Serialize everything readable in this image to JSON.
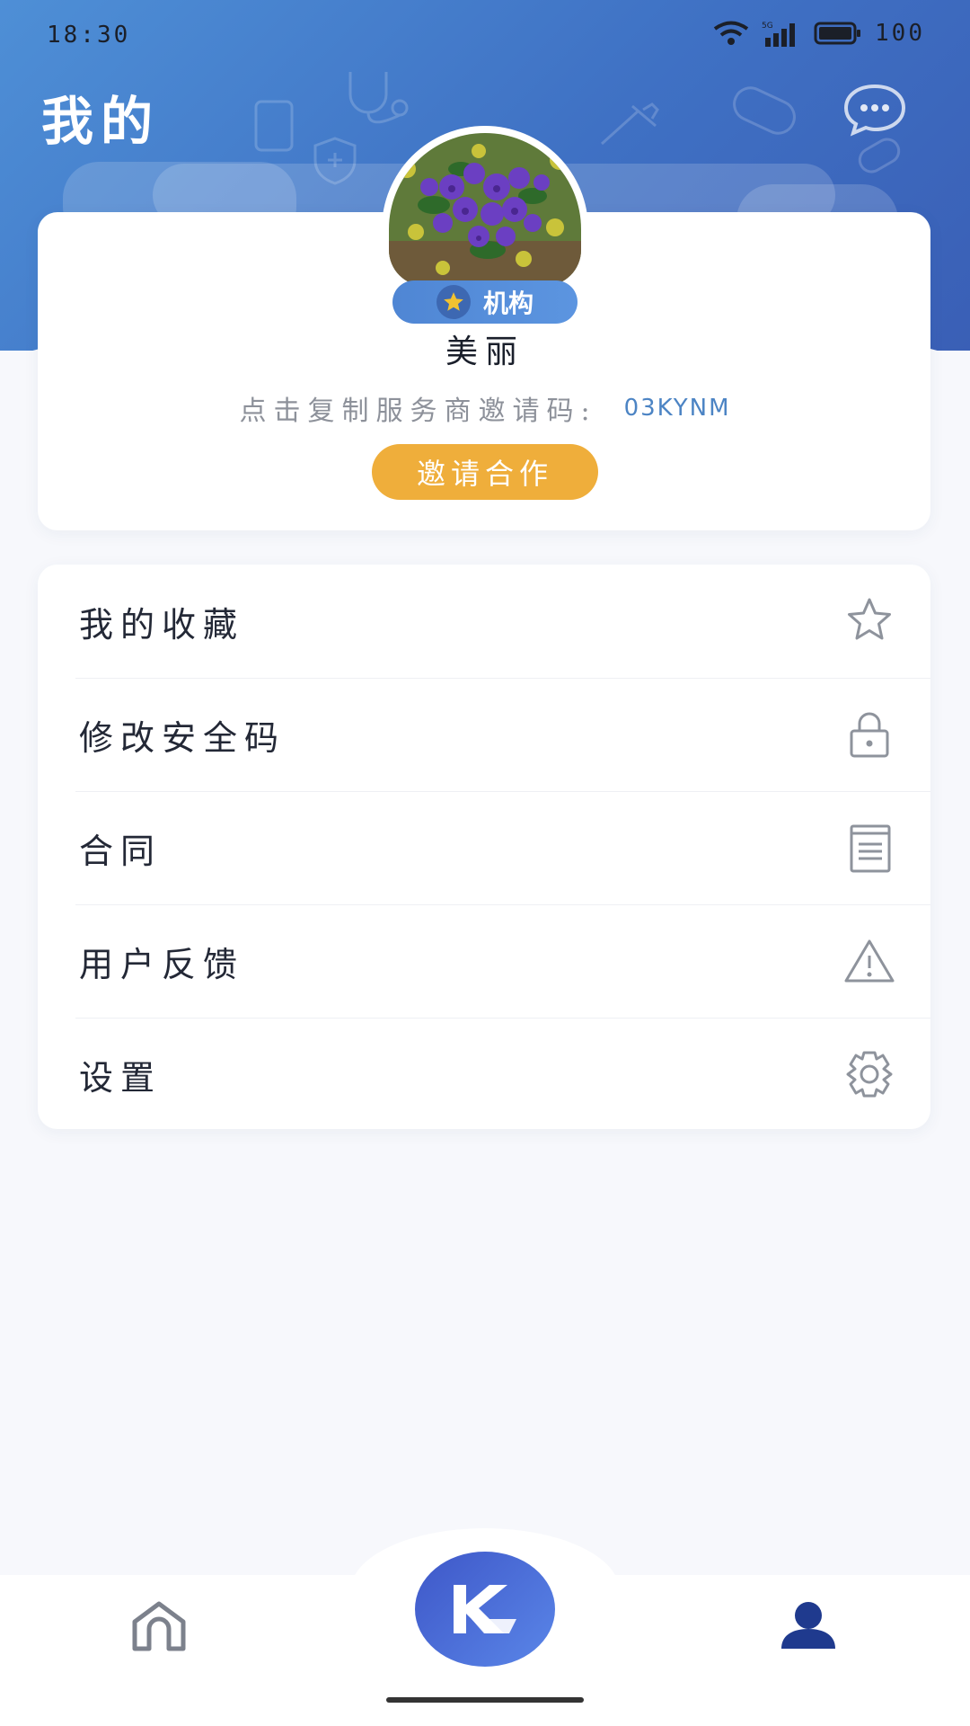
{
  "status_bar": {
    "time": "18:30",
    "network": "5G",
    "battery": "100",
    "icons": [
      "wifi-icon",
      "signal-5g-icon",
      "battery-icon"
    ]
  },
  "header": {
    "title": "我的",
    "chat_icon": "chat-bubble-icon"
  },
  "profile": {
    "avatar": "flower-photo-avatar",
    "role_badge": "机构",
    "role_icon": "star-icon",
    "name": "美丽",
    "invite_label": "点击复制服务商邀请码:",
    "invite_code": "03KYNM",
    "invite_button": "邀请合作"
  },
  "menu": {
    "items": [
      {
        "label": "我的收藏",
        "icon": "star-outline-icon"
      },
      {
        "label": "修改安全码",
        "icon": "lock-icon"
      },
      {
        "label": "合同",
        "icon": "document-icon"
      },
      {
        "label": "用户反馈",
        "icon": "warning-icon"
      },
      {
        "label": "设置",
        "icon": "gear-icon"
      }
    ]
  },
  "tab_bar": {
    "items": [
      {
        "name": "home",
        "icon": "home-icon"
      },
      {
        "name": "center",
        "icon": "k-logo-icon"
      },
      {
        "name": "profile",
        "icon": "person-icon",
        "active": true
      }
    ]
  },
  "colors": {
    "header_blue": "#3f71c4",
    "accent_orange": "#efae3b",
    "badge_blue": "#5689d8",
    "code_blue": "#4c84c4",
    "active_tab": "#1f3a8e"
  }
}
